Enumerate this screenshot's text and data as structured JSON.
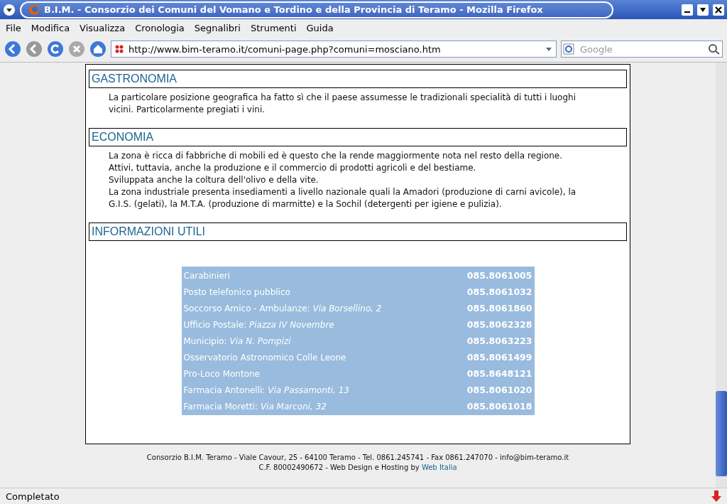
{
  "window": {
    "title": "B.I.M. - Consorzio dei Comuni del Vomano e Tordino e della Provincia di Teramo - Mozilla Firefox"
  },
  "menu": [
    "File",
    "Modifica",
    "Visualizza",
    "Cronologia",
    "Segnalibri",
    "Strumenti",
    "Guida"
  ],
  "address": {
    "value": "http://www.bim-teramo.it/comuni-page.php?comuni=mosciano.htm"
  },
  "search": {
    "placeholder": "Google"
  },
  "sections": [
    {
      "heading": "GASTRONOMIA",
      "paragraphs": [
        "La particolare posizione geografica ha fatto sì che il paese assumesse le tradizionali specialità di tutti i luoghi vicini. Particolarmente pregiati i vini."
      ]
    },
    {
      "heading": "ECONOMIA",
      "paragraphs": [
        "La zona è ricca di fabbriche di mobili ed è questo che la rende maggiormente nota nel resto della regione. Attivi, tuttavia, anche la produzione e il commercio di prodotti agricoli e del bestiame.",
        "Sviluppata anche la coltura dell'olivo e della vite.",
        "La zona industriale presenta insediamenti a livello nazionale quali la Amadori (produzione di carni avicole), la G.I.S. (gelati), la M.T.A. (produzione di marmitte) e la Sochil (detergenti per igiene e pulizia)."
      ]
    },
    {
      "heading": "INFORMAZIONI UTILI"
    }
  ],
  "contacts": [
    {
      "name": "Carabinieri",
      "phone": "085.8061005"
    },
    {
      "name": "Posto telefonico pubblico",
      "phone": "085.8061032"
    },
    {
      "name": "Soccorso Amico - Ambulanze: *Via Borsellino, 2*",
      "phone": "085.8061860"
    },
    {
      "name": "Ufficio Postale: *Piazza IV Novembre*",
      "phone": "085.8062328"
    },
    {
      "name": "Municipio: *Via N. Pompizi*",
      "phone": "085.8063223"
    },
    {
      "name": "Osservatorio Astronomico Colle Leone",
      "phone": "085.8061499"
    },
    {
      "name": "Pro-Loco Montone",
      "phone": "085.8648121"
    },
    {
      "name": "Farmacia Antonelli: *Via Passamonti, 13*",
      "phone": "085.8061020"
    },
    {
      "name": "Farmacia Moretti: *Via Marconi, 32*",
      "phone": "085.8061018"
    }
  ],
  "footer": {
    "line1": "Consorzio B.I.M. Teramo - Viale Cavour, 25 - 64100 Teramo - Tel. 0861.245741 - Fax 0861.247070 - info@bim-teramo.it",
    "line2": "C.F. 80002490672 - Web Design e Hosting by",
    "link": "Web Italia"
  },
  "status_bar": {
    "text": "Completato"
  }
}
